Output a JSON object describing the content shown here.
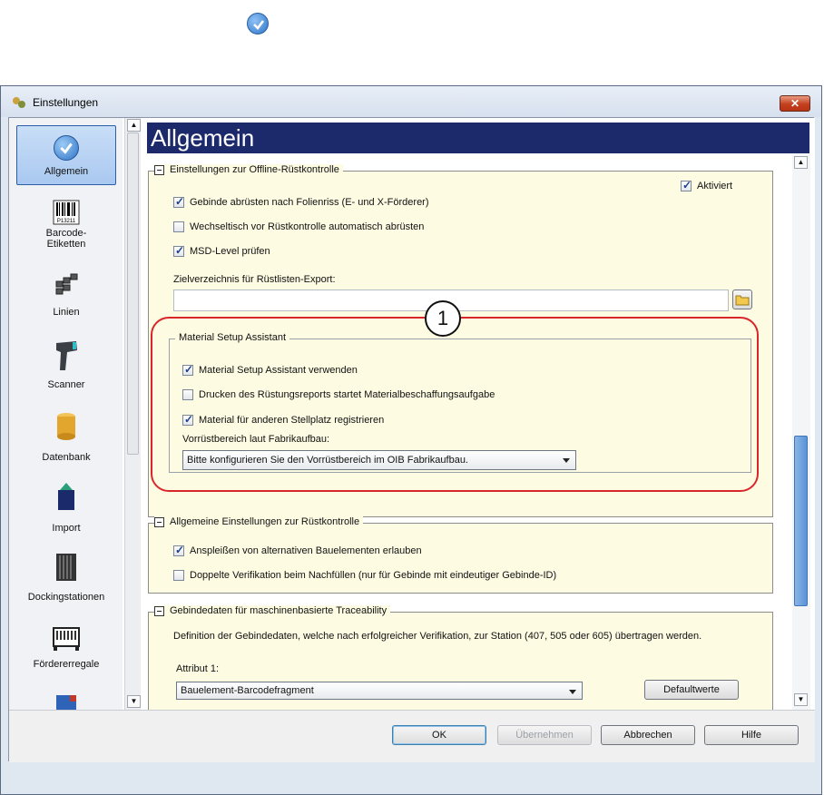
{
  "window": {
    "title": "Einstellungen",
    "close_label": "✕"
  },
  "page_title": "Allgemein",
  "nav": [
    {
      "label": "Allgemein"
    },
    {
      "label": "Barcode-\nEtiketten",
      "icon_text": "P13211"
    },
    {
      "label": "Linien"
    },
    {
      "label": "Scanner"
    },
    {
      "label": "Datenbank"
    },
    {
      "label": "Import"
    },
    {
      "label": "Dockingstationen"
    },
    {
      "label": "Fördererregale"
    }
  ],
  "offline": {
    "title": "Einstellungen zur Offline-Rüstkontrolle",
    "aktiviert": "Aktiviert",
    "cb1": "Gebinde abrüsten nach Folienriss (E- und X-Förderer)",
    "cb2": "Wechseltisch vor Rüstkontrolle automatisch abrüsten",
    "cb3": "MSD-Level prüfen",
    "zielverzeichnis_label": "Zielverzeichnis für Rüstlisten-Export:",
    "zielverzeichnis_value": ""
  },
  "msa": {
    "title": "Material Setup Assistant",
    "cb1": "Material Setup Assistant verwenden",
    "cb2": "Drucken des Rüstungsreports startet Materialbeschaffungsaufgabe",
    "cb3": "Material für anderen Stellplatz registrieren",
    "vorrust_label": "Vorrüstbereich laut Fabrikaufbau:",
    "vorrust_value": "Bitte konfigurieren Sie den Vorrüstbereich im OIB Fabrikaufbau."
  },
  "general": {
    "title": "Allgemeine Einstellungen zur Rüstkontrolle",
    "cb1": "Anspleißen von alternativen Bauelementen erlauben",
    "cb2": "Doppelte Verifikation beim Nachfüllen (nur für Gebinde mit eindeutiger Gebinde-ID)"
  },
  "trace": {
    "title": "Gebindedaten für maschinenbasierte Traceability",
    "desc": "Definition der Gebindedaten, welche nach erfolgreicher Verifikation, zur Station (407, 505 oder 605) übertragen werden.",
    "attr_label": "Attribut 1:",
    "attr_value": "Bauelement-Barcodefragment",
    "default_btn": "Defaultwerte"
  },
  "buttons": {
    "ok": "OK",
    "apply": "Übernehmen",
    "cancel": "Abbrechen",
    "help": "Hilfe"
  },
  "callout": "1"
}
